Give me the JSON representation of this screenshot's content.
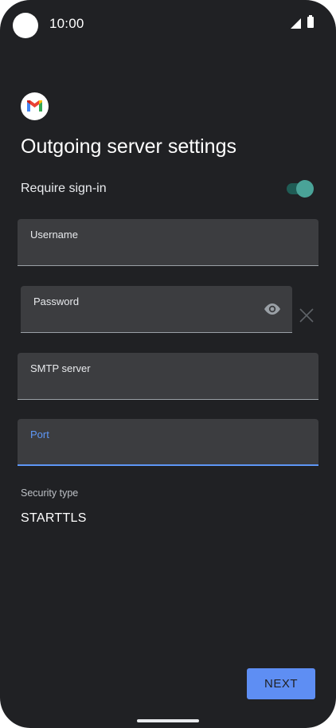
{
  "status_bar": {
    "time": "10:00"
  },
  "screen": {
    "title": "Outgoing server settings"
  },
  "require_sign_in": {
    "label": "Require sign-in",
    "enabled": true
  },
  "fields": {
    "username": {
      "label": "Username",
      "value": ""
    },
    "password": {
      "label": "Password",
      "value": ""
    },
    "smtp_server": {
      "label": "SMTP server",
      "value": ""
    },
    "port": {
      "label": "Port",
      "value": ""
    }
  },
  "security": {
    "label": "Security type",
    "value": "STARTTLS"
  },
  "actions": {
    "next_label": "NEXT"
  },
  "icons": {
    "logo": "gmail-logo-icon",
    "password_toggle": "eye-icon",
    "clear": "close-icon",
    "dropdown": "caret-down-icon"
  },
  "colors": {
    "accent": "#5e8ef3",
    "toggle_on": "#4aa398",
    "background": "#202124"
  }
}
